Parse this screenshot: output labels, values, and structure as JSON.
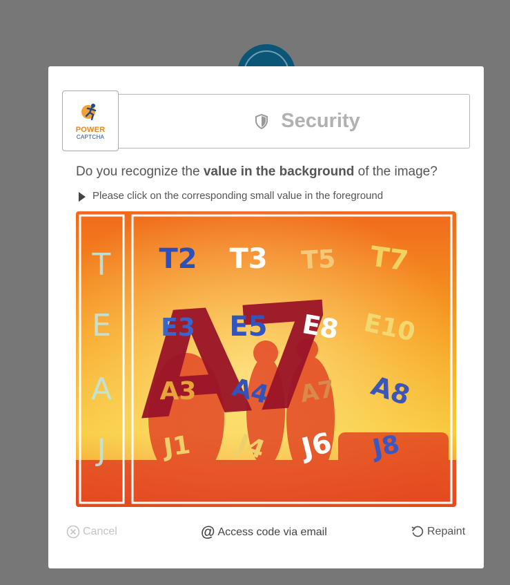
{
  "brand": {
    "name": "POWER",
    "sub": "CAPTCHA"
  },
  "header": {
    "title": "Security",
    "icon": "shield-icon"
  },
  "prompt": {
    "question_pre": "Do you recognize the ",
    "question_bold": "value in the background",
    "question_post": " of the image?",
    "hint": "Please click on the corresponding small value in the foreground"
  },
  "captcha": {
    "background_value": "A7",
    "side_letters": [
      "T",
      "E",
      "A",
      "J"
    ],
    "options": [
      {
        "label": "T2",
        "color": "#2e4fb8"
      },
      {
        "label": "T3",
        "color": "#ffffff"
      },
      {
        "label": "T5",
        "color": "#f4c97a"
      },
      {
        "label": "T7",
        "color": "#f2d260"
      },
      {
        "label": "E3",
        "color": "#3b63c9"
      },
      {
        "label": "E5",
        "color": "#2f55bf"
      },
      {
        "label": "E8",
        "color": "#ffffff"
      },
      {
        "label": "E10",
        "color": "#f3d870"
      },
      {
        "label": "A3",
        "color": "#e8a33a"
      },
      {
        "label": "A4",
        "color": "#3552b8"
      },
      {
        "label": "A7",
        "color": "#d9894a"
      },
      {
        "label": "A8",
        "color": "#3c55b6"
      },
      {
        "label": "J1",
        "color": "#f0cf6a"
      },
      {
        "label": "J4",
        "color": "#f0cf6a"
      },
      {
        "label": "J6",
        "color": "#ffffff"
      },
      {
        "label": "J8",
        "color": "#3b58c0"
      }
    ]
  },
  "footer": {
    "cancel": "Cancel",
    "email": "Access code via email",
    "repaint": "Repaint"
  },
  "colors": {
    "overlay": "#777777",
    "title_text": "#b1b1b1",
    "brand_orange": "#e8891c",
    "brand_blue": "#1f4a8a",
    "background_glyph": "#9b1428"
  }
}
